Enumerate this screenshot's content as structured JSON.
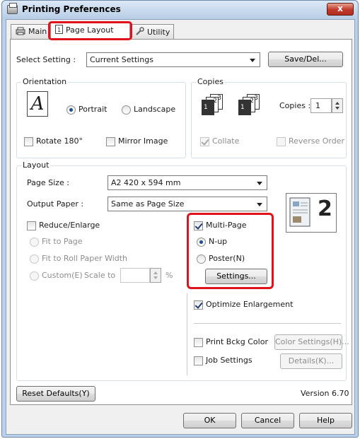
{
  "window": {
    "title": "Printing Preferences",
    "close_label": "x"
  },
  "tabs": [
    {
      "label": "Main"
    },
    {
      "label": "Page Layout"
    },
    {
      "label": "Utility"
    }
  ],
  "select_setting": {
    "label": "Select Setting :",
    "value": "Current Settings",
    "save_button": "Save/Del..."
  },
  "orientation": {
    "title": "Orientation",
    "icon_letter": "A",
    "portrait": "Portrait",
    "landscape": "Landscape",
    "selected": "portrait",
    "rotate_label": "Rotate 180°",
    "mirror_label": "Mirror Image"
  },
  "copies": {
    "title": "Copies",
    "copies_label": "Copies :",
    "value": "1",
    "collate_label": "Collate",
    "reverse_label": "Reverse Order",
    "icon_digits": [
      "1",
      "2",
      "3"
    ]
  },
  "layout": {
    "title": "Layout",
    "page_size_label": "Page Size :",
    "page_size_value": "A2 420 x 594 mm",
    "output_paper_label": "Output Paper :",
    "output_paper_value": "Same as Page Size",
    "reduce_enlarge_label": "Reduce/Enlarge",
    "fit_to_page": "Fit to Page",
    "fit_to_roll": "Fit to Roll Paper Width",
    "custom_label": "Custom(E)",
    "scale_label": "Scale to",
    "scale_unit": "%",
    "multi_page_label": "Multi-Page",
    "nup_label": "N-up",
    "poster_label": "Poster(N)",
    "settings_button": "Settings...",
    "preview_number": "2",
    "optimize_label": "Optimize Enlargement",
    "print_bckg_label": "Print Bckg Color",
    "color_settings_button": "Color Settings(H)...",
    "job_settings_label": "Job Settings",
    "details_button": "Details(K)..."
  },
  "footer": {
    "reset_button": "Reset Defaults(Y)",
    "version": "Version 6.70",
    "ok": "OK",
    "cancel": "Cancel",
    "help": "Help"
  },
  "colors": {
    "highlight": "#e0121c",
    "titlebar": "#b9d1ea",
    "close": "#c0392b"
  }
}
